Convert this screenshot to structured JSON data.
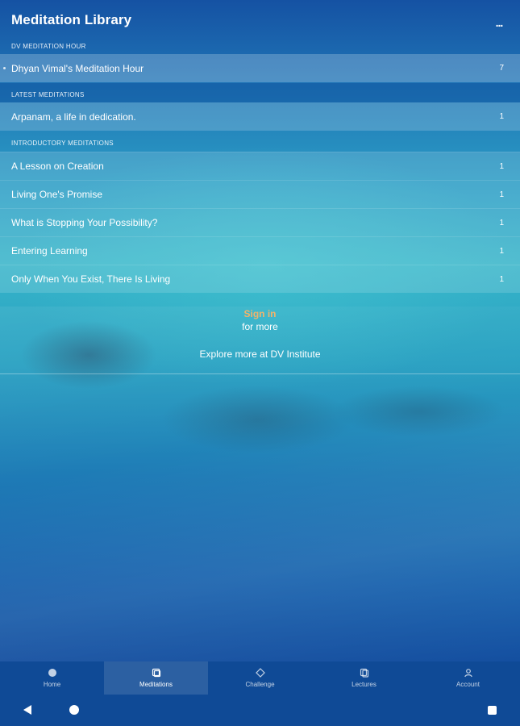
{
  "header": {
    "title": "Meditation Library",
    "more_label": "..."
  },
  "sections": [
    {
      "label": "DV MEDITATION HOUR",
      "items": [
        {
          "title": "Dhyan Vimal's Meditation Hour",
          "count": "7"
        }
      ]
    },
    {
      "label": "LATEST MEDITATIONS",
      "items": [
        {
          "title": "Arpanam, a life in dedication.",
          "count": "1"
        }
      ]
    },
    {
      "label": "INTRODUCTORY MEDITATIONS",
      "items": [
        {
          "title": "A Lesson on Creation",
          "count": "1"
        },
        {
          "title": "Living One's Promise",
          "count": "1"
        },
        {
          "title": "What is Stopping Your Possibility?",
          "count": "1"
        },
        {
          "title": "Entering Learning",
          "count": "1"
        },
        {
          "title": "Only When You Exist, There Is Living",
          "count": "1"
        }
      ]
    }
  ],
  "sign_in": {
    "link": "Sign in",
    "sub": "for more",
    "explore": "Explore more at DV Institute"
  },
  "tabs": [
    {
      "label": "Home",
      "icon": "home-icon"
    },
    {
      "label": "Meditations",
      "icon": "meditations-icon",
      "active": true
    },
    {
      "label": "Challenge",
      "icon": "challenge-icon"
    },
    {
      "label": "Lectures",
      "icon": "lectures-icon"
    },
    {
      "label": "Account",
      "icon": "account-icon"
    }
  ],
  "colors": {
    "accent_sign_in": "#f1b36b",
    "nav_bar": "#0f4a96"
  }
}
